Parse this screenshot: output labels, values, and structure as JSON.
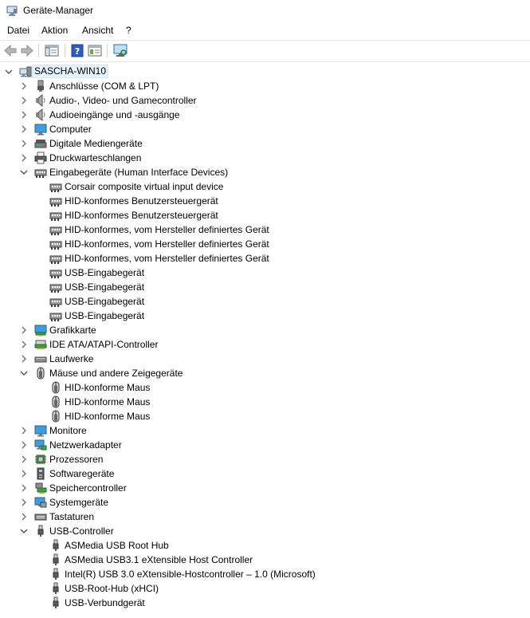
{
  "window": {
    "title": "Geräte-Manager"
  },
  "menu": [
    "Datei",
    "Aktion",
    "Ansicht",
    "?"
  ],
  "tree": [
    {
      "label": "SASCHA-WIN10",
      "level": 0,
      "expander": "down",
      "icon": "computer-root-icon",
      "name": "tree-root-computer"
    },
    {
      "label": "Anschlüsse (COM & LPT)",
      "level": 1,
      "expander": "right",
      "icon": "port-icon",
      "name": "tree-category-ports"
    },
    {
      "label": "Audio-, Video- und Gamecontroller",
      "level": 1,
      "expander": "right",
      "icon": "speaker-icon",
      "name": "tree-category-audio-video"
    },
    {
      "label": "Audioeingänge und -ausgänge",
      "level": 1,
      "expander": "right",
      "icon": "speaker-icon",
      "name": "tree-category-audio-io"
    },
    {
      "label": "Computer",
      "level": 1,
      "expander": "right",
      "icon": "monitor-icon",
      "name": "tree-category-computer"
    },
    {
      "label": "Digitale Mediengeräte",
      "level": 1,
      "expander": "right",
      "icon": "media-device-icon",
      "name": "tree-category-media-devices"
    },
    {
      "label": "Druckwarteschlangen",
      "level": 1,
      "expander": "right",
      "icon": "printer-icon",
      "name": "tree-category-print-queues"
    },
    {
      "label": "Eingabegeräte (Human Interface Devices)",
      "level": 1,
      "expander": "down",
      "icon": "hid-icon",
      "name": "tree-category-hid"
    },
    {
      "label": "Corsair composite virtual input device",
      "level": 2,
      "icon": "hid-icon",
      "name": "tree-device-hid"
    },
    {
      "label": "HID-konformes Benutzersteuergerät",
      "level": 2,
      "icon": "hid-icon",
      "name": "tree-device-hid"
    },
    {
      "label": "HID-konformes Benutzersteuergerät",
      "level": 2,
      "icon": "hid-icon",
      "name": "tree-device-hid"
    },
    {
      "label": "HID-konformes, vom Hersteller definiertes Gerät",
      "level": 2,
      "icon": "hid-icon",
      "name": "tree-device-hid"
    },
    {
      "label": "HID-konformes, vom Hersteller definiertes Gerät",
      "level": 2,
      "icon": "hid-icon",
      "name": "tree-device-hid"
    },
    {
      "label": "HID-konformes, vom Hersteller definiertes Gerät",
      "level": 2,
      "icon": "hid-icon",
      "name": "tree-device-hid"
    },
    {
      "label": "USB-Eingabegerät",
      "level": 2,
      "icon": "hid-icon",
      "name": "tree-device-hid"
    },
    {
      "label": "USB-Eingabegerät",
      "level": 2,
      "icon": "hid-icon",
      "name": "tree-device-hid"
    },
    {
      "label": "USB-Eingabegerät",
      "level": 2,
      "icon": "hid-icon",
      "name": "tree-device-hid"
    },
    {
      "label": "USB-Eingabegerät",
      "level": 2,
      "icon": "hid-icon",
      "name": "tree-device-hid"
    },
    {
      "label": "Grafikkarte",
      "level": 1,
      "expander": "right",
      "icon": "display-adapter-icon",
      "name": "tree-category-display-adapters"
    },
    {
      "label": "IDE ATA/ATAPI-Controller",
      "level": 1,
      "expander": "right",
      "icon": "ide-controller-icon",
      "name": "tree-category-ide"
    },
    {
      "label": "Laufwerke",
      "level": 1,
      "expander": "right",
      "icon": "disk-drive-icon",
      "name": "tree-category-drives"
    },
    {
      "label": "Mäuse und andere Zeigegeräte",
      "level": 1,
      "expander": "down",
      "icon": "mouse-icon",
      "name": "tree-category-mice"
    },
    {
      "label": "HID-konforme Maus",
      "level": 2,
      "icon": "mouse-icon",
      "name": "tree-device-mouse"
    },
    {
      "label": "HID-konforme Maus",
      "level": 2,
      "icon": "mouse-icon",
      "name": "tree-device-mouse"
    },
    {
      "label": "HID-konforme Maus",
      "level": 2,
      "icon": "mouse-icon",
      "name": "tree-device-mouse"
    },
    {
      "label": "Monitore",
      "level": 1,
      "expander": "right",
      "icon": "monitor-icon",
      "name": "tree-category-monitors"
    },
    {
      "label": "Netzwerkadapter",
      "level": 1,
      "expander": "right",
      "icon": "network-adapter-icon",
      "name": "tree-category-network"
    },
    {
      "label": "Prozessoren",
      "level": 1,
      "expander": "right",
      "icon": "processor-icon",
      "name": "tree-category-processors"
    },
    {
      "label": "Softwaregeräte",
      "level": 1,
      "expander": "right",
      "icon": "software-device-icon",
      "name": "tree-category-software-devices"
    },
    {
      "label": "Speichercontroller",
      "level": 1,
      "expander": "right",
      "icon": "storage-controller-icon",
      "name": "tree-category-storage"
    },
    {
      "label": "Systemgeräte",
      "level": 1,
      "expander": "right",
      "icon": "system-device-icon",
      "name": "tree-category-system"
    },
    {
      "label": "Tastaturen",
      "level": 1,
      "expander": "right",
      "icon": "keyboard-icon",
      "name": "tree-category-keyboards"
    },
    {
      "label": "USB-Controller",
      "level": 1,
      "expander": "down",
      "icon": "usb-icon",
      "name": "tree-category-usb"
    },
    {
      "label": "ASMedia USB Root Hub",
      "level": 2,
      "icon": "usb-icon",
      "name": "tree-device-usb"
    },
    {
      "label": "ASMedia USB3.1 eXtensible Host Controller",
      "level": 2,
      "icon": "usb-icon",
      "name": "tree-device-usb"
    },
    {
      "label": "Intel(R) USB 3.0 eXtensible-Hostcontroller – 1.0 (Microsoft)",
      "level": 2,
      "icon": "usb-icon",
      "name": "tree-device-usb"
    },
    {
      "label": "USB-Root-Hub (xHCI)",
      "level": 2,
      "icon": "usb-icon",
      "name": "tree-device-usb"
    },
    {
      "label": "USB-Verbundgerät",
      "level": 2,
      "icon": "usb-icon",
      "name": "tree-device-usb"
    }
  ]
}
